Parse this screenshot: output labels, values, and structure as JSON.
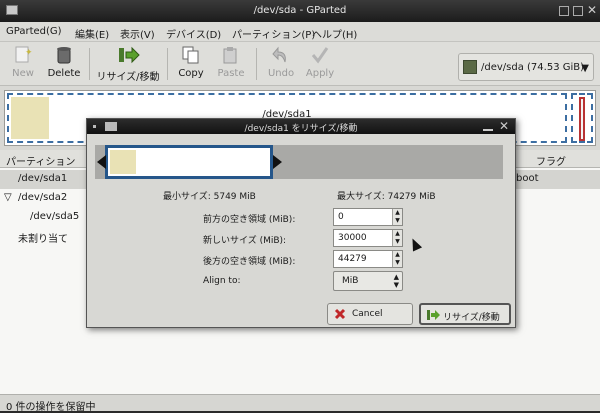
{
  "window": {
    "title": "/dev/sda - GParted"
  },
  "menubar": {
    "items": [
      "GParted(G)",
      "編集(E)",
      "表示(V)",
      "デバイス(D)",
      "パーティション(P)",
      "ヘルプ(H)"
    ]
  },
  "toolbar": {
    "new_label": "New",
    "delete_label": "Delete",
    "resize_move_label": "リサイズ/移動",
    "copy_label": "Copy",
    "paste_label": "Paste",
    "undo_label": "Undo",
    "apply_label": "Apply"
  },
  "device_selector": {
    "value": "/dev/sda  (74.53 GiB)"
  },
  "partition_map": {
    "selected_partition": "/dev/sda1"
  },
  "partition_list": {
    "headers": {
      "partition": "パーティション",
      "flags": "フラグ"
    },
    "rows": [
      {
        "name": "/dev/sda1",
        "flags": "boot",
        "indent": 0,
        "expander": ""
      },
      {
        "name": "/dev/sda2",
        "flags": "",
        "indent": 0,
        "expander": "▽"
      },
      {
        "name": "/dev/sda5",
        "flags": "",
        "indent": 1,
        "expander": ""
      },
      {
        "name": "未割り当て",
        "flags": "",
        "indent": 0,
        "expander": ""
      }
    ]
  },
  "statusbar": {
    "text": "0 件の操作を保留中"
  },
  "dialog": {
    "title": "/dev/sda1 をリサイズ/移動",
    "min_size_label": "最小サイズ: 5749 MiB",
    "max_size_label": "最大サイズ: 74279 MiB",
    "free_before_label": "前方の空き領域 (MiB):",
    "free_before_value": "0",
    "new_size_label": "新しいサイズ (MiB):",
    "new_size_value": "30000",
    "free_after_label": "後方の空き領域 (MiB):",
    "free_after_value": "44279",
    "align_label": "Align to:",
    "align_value": "MiB",
    "cancel_label": "Cancel",
    "resize_move_label": "リサイズ/移動"
  },
  "colors": {
    "partition_border": "#3c6ea2",
    "used_space": "#e9e2b5",
    "extended_border": "#b83232",
    "resizer_border": "#25568a"
  }
}
